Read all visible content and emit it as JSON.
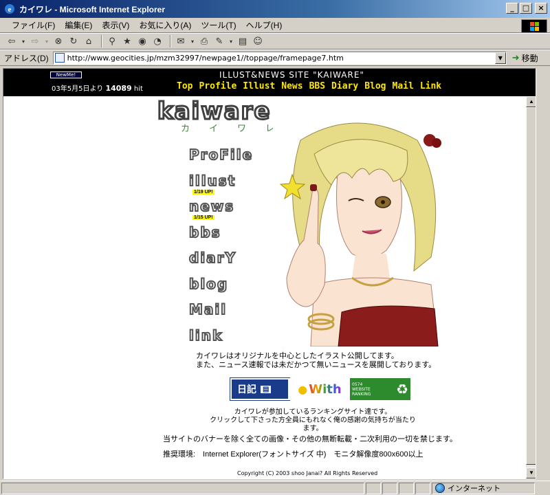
{
  "window": {
    "title": "カイワレ - Microsoft Internet Explorer",
    "minimize_icon": "minimize-icon",
    "maximize_icon": "maximize-icon",
    "close_icon": "close-icon"
  },
  "menu": {
    "items": [
      "ファイル(F)",
      "編集(E)",
      "表示(V)",
      "お気に入り(A)",
      "ツール(T)",
      "ヘルプ(H)"
    ]
  },
  "toolbar": {
    "icons": [
      "back-icon",
      "forward-icon",
      "stop-icon",
      "refresh-icon",
      "home-icon",
      "search-icon",
      "favorites-icon",
      "media-icon",
      "history-icon",
      "mail-icon",
      "print-icon",
      "edit-icon",
      "discuss-icon"
    ]
  },
  "address": {
    "label": "アドレス(D)",
    "url": "http://www.geocities.jp/mzm32997/newpage1//toppage/framepage7.htm",
    "go_label": "移動"
  },
  "header": {
    "badge": "NewMe!",
    "counter_prefix": "03年5月5日より",
    "counter_value": "14089",
    "counter_suffix": "hit",
    "site_title": "ILLUST&NEWS SITE \"KAIWARE\"",
    "nav": [
      "Top",
      "Profile",
      "Illust",
      "News",
      "BBS",
      "Diary",
      "Blog",
      "Mail",
      "Link"
    ]
  },
  "main": {
    "logo": "kaiware",
    "logo_sub": "カイワレ",
    "menu": [
      {
        "label": "ProFile",
        "update": ""
      },
      {
        "label": "illust",
        "update": "1/19 UP!"
      },
      {
        "label": "news",
        "update": "1/15 UP!"
      },
      {
        "label": "bbs",
        "update": ""
      },
      {
        "label": "diarY",
        "update": ""
      },
      {
        "label": "blog",
        "update": ""
      },
      {
        "label": "Mail",
        "update": ""
      },
      {
        "label": "link",
        "update": ""
      }
    ],
    "intro_line1": "カイワレはオリジナルを中心としたイラスト公開してます。",
    "intro_line2": "また、ニュース速報では未だかつて無いニュースを展開しております。",
    "banners": {
      "diary": "日記",
      "with": "With",
      "ranking_title": "0574 WEBSITE RANKING"
    },
    "ranking_line1": "カイワレが参加しているランキングサイト達です。",
    "ranking_line2": "クリックして下さった方全員にもれなく俺の感謝の気持ちが当たります。",
    "notice": "当サイトのバナーを除く全ての画像・その他の無断転載・二次利用の一切を禁じます。",
    "env": "推奨環境:　Internet Explorer(フォントサイズ 中)　モニタ解像度800x600以上",
    "copyright": "Copyright (C) 2003 shoo Janai? All Rights Reserved"
  },
  "status": {
    "zone": "インターネット",
    "zone_icon": "globe-icon"
  },
  "colors": {
    "titlebar": "#0a246a",
    "nav_link": "#ffe800",
    "header_bg": "#000000"
  }
}
